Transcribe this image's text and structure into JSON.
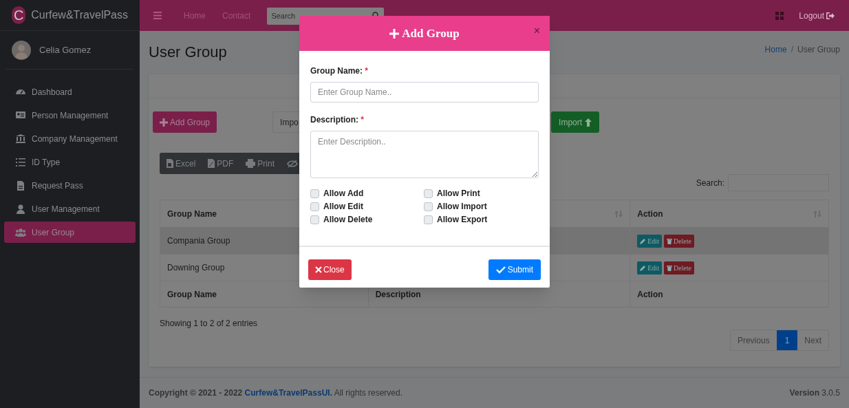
{
  "brand": {
    "logo_letter": "C",
    "name": "Curfew&TravelPass"
  },
  "user": {
    "name": "Celia Gomez"
  },
  "sidebar": {
    "items": [
      {
        "label": "Dashboard",
        "selected": false
      },
      {
        "label": "Person Management",
        "selected": false
      },
      {
        "label": "Company Management",
        "selected": false
      },
      {
        "label": "ID Type",
        "selected": false
      },
      {
        "label": "Request Pass",
        "selected": false
      },
      {
        "label": "User Management",
        "selected": false
      },
      {
        "label": "User Group",
        "selected": true
      }
    ]
  },
  "navbar": {
    "links": [
      "Home",
      "Contact"
    ],
    "search": {
      "placeholder": "Search"
    },
    "logout": "Logout"
  },
  "page": {
    "title": "User Group",
    "breadcrumb_separator": "/",
    "breadcrumb": [
      {
        "label": "Home",
        "link": true
      },
      {
        "label": "User Group",
        "link": false
      }
    ]
  },
  "toolbar": {
    "add_button": "Add Group",
    "import_field": "Impo",
    "import_button": "Import"
  },
  "export_buttons": [
    "Excel",
    "PDF",
    "Print"
  ],
  "table": {
    "search_label": "Search:",
    "header": {
      "column_1": "Group Name",
      "column_3": "Action"
    },
    "rows": [
      {
        "group_name": "Compania Group",
        "actions": [
          "Edit",
          "Delete"
        ]
      },
      {
        "group_name": "Downing Group",
        "actions": [
          "Edit",
          "Delete"
        ]
      }
    ],
    "footer": {
      "column_1": "Group Name",
      "column_2": "Description",
      "column_3": "Action"
    },
    "info": "Showing 1 to 2 of 2 entries",
    "pagination": [
      {
        "label": "Previous",
        "selected": false
      },
      {
        "label": "1",
        "selected": true
      },
      {
        "label": "Next",
        "selected": false
      }
    ]
  },
  "footer": {
    "copyright": "**Copyright © 2021 - 2022**",
    "link": "Curfew&TravelPassUI.",
    "rights": "All rights reserved.",
    "version": "**Version** 3.0.5"
  },
  "modal": {
    "title": "Add Group",
    "close": "×",
    "fields": [
      {
        "kind": "input",
        "label": "Group Name:",
        "required_mark": "*",
        "placeholder": "Enter Group Name.."
      },
      {
        "kind": "textarea",
        "label": "Description:",
        "required_mark": "*",
        "placeholder": "Enter Description.."
      }
    ],
    "permissions": [
      {
        "label": "Allow Add",
        "checked": false
      },
      {
        "label": "Allow Edit",
        "checked": false
      },
      {
        "label": "Allow Delete",
        "checked": false
      },
      {
        "label": "Allow Print",
        "checked": false
      },
      {
        "label": "Allow Import",
        "checked": false
      },
      {
        "label": "Allow Export",
        "checked": false
      }
    ],
    "close_button": "Close",
    "submit_button": "Submit"
  }
}
